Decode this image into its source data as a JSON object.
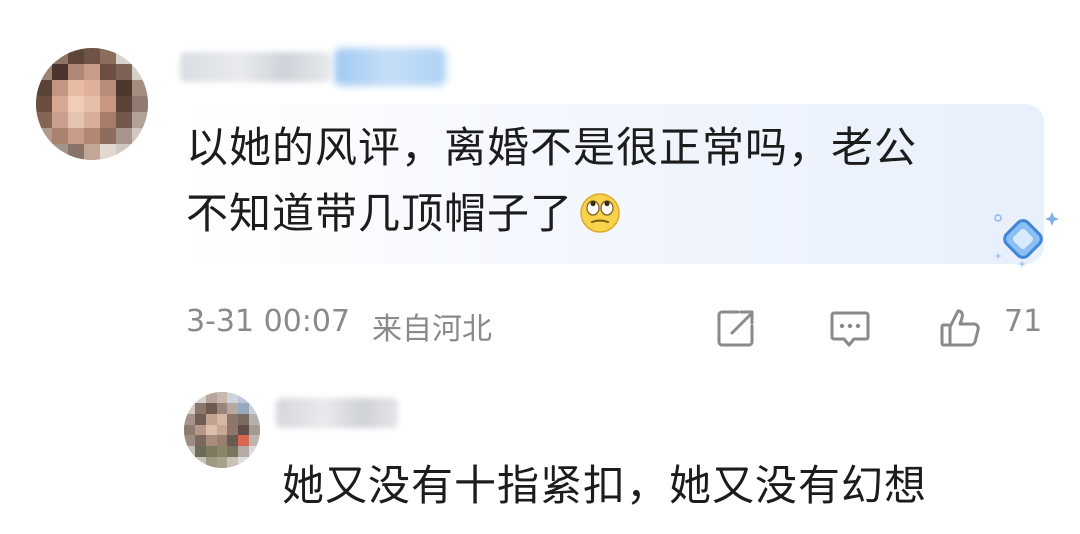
{
  "main_comment": {
    "text_line1": "以她的风评，离婚不是很正常吗，老公",
    "text_line2": "不知道带几顶帽子了",
    "emoji": "eye-roll-emoji",
    "time": "3-31 00:07",
    "location": "来自河北",
    "like_count": "71"
  },
  "reply": {
    "text": "她又没有十指紧扣，她又没有幻想"
  },
  "icons": {
    "share": "share-icon",
    "reply": "comment-icon",
    "like": "thumbs-up-icon",
    "decoration": "diamond-icon"
  },
  "colors": {
    "text": "#1c1c1c",
    "meta": "#8a8a8a",
    "bubble": "#eef3fc",
    "badge": "#a9cdf4",
    "diamond": "#4a90e2"
  }
}
